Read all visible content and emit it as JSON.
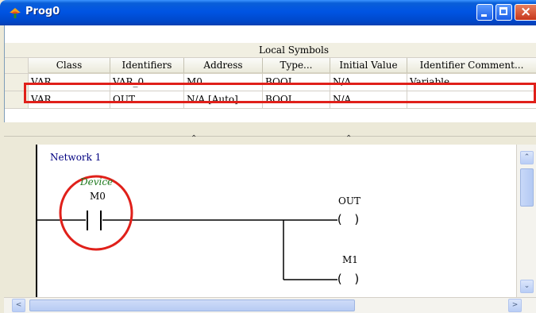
{
  "window": {
    "title": "Prog0",
    "minimize_icon": "minimize-icon",
    "maximize_icon": "maximize-icon",
    "close_icon": "close-icon"
  },
  "symbols": {
    "title": "Local Symbols",
    "columns": [
      "Class",
      "Identifiers",
      "Address",
      "Type...",
      "Initial Value",
      "Identifier Comment..."
    ],
    "rows": [
      [
        "VAR",
        "VAR_0",
        "M0",
        "BOOL",
        "N/A",
        "Variable"
      ],
      [
        "VAR",
        "OUT",
        "N/A [Auto]",
        "BOOL",
        "N/A",
        ""
      ]
    ],
    "highlight_row": 0
  },
  "splitter": {
    "arrow_left": "⌃",
    "arrow_right": "⌃"
  },
  "ladder": {
    "network_label": "Network 1",
    "contact": {
      "comment": "Device",
      "address": "M0"
    },
    "coils": [
      {
        "name": "OUT",
        "symbol": "( )"
      },
      {
        "name": "M1",
        "symbol": "( )"
      }
    ]
  },
  "scrollbars": {
    "up_arrow": "⌃",
    "down_arrow": "⌄",
    "left_arrow": "<",
    "right_arrow": ">"
  },
  "colors": {
    "highlight": "#e0201a",
    "network_label": "#000080",
    "device_comment": "#1f7a1f",
    "titlebar": "#0054e3"
  }
}
